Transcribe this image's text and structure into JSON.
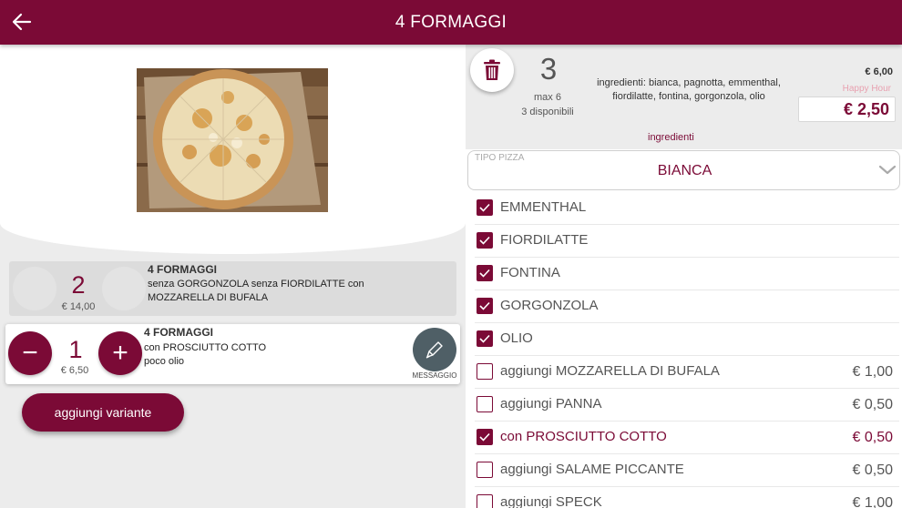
{
  "header": {
    "title": "4 FORMAGGI",
    "back_icon": "arrow-left-icon"
  },
  "colors": {
    "brand": "#7b0a36",
    "happy_hour": "#e8a1b0",
    "message_button": "#4f5f66"
  },
  "order_lines": [
    {
      "qty": "2",
      "price": "€ 14,00",
      "title": "4 FORMAGGI",
      "desc": " senza GORGONZOLA senza FIORDILATTE con MOZZARELLA DI BUFALA"
    },
    {
      "qty": "1",
      "price": "€ 6,50",
      "title": "4 FORMAGGI",
      "desc": " con PROSCIUTTO COTTO",
      "note": "poco olio"
    }
  ],
  "buttons": {
    "minus": "−",
    "plus": "+",
    "message": "MESSAGGIO",
    "add_variant": "aggiungi variante"
  },
  "detail": {
    "qty": "3",
    "max": "max 6",
    "available": "3 disponibili",
    "ingredients_desc": "ingredienti: bianca, pagnotta, emmenthal, fiordilatte, fontina, gorgonzola, olio",
    "old_price": "€ 6,00",
    "happy_hour": "Happy Hour",
    "price": "€ 2,50",
    "ingredients_tab": "ingredienti"
  },
  "pizza_type": {
    "label": "TIPO PIZZA",
    "value": "BIANCA"
  },
  "options": [
    {
      "name": "EMMENTHAL",
      "price": "",
      "checked": true
    },
    {
      "name": "FIORDILATTE",
      "price": "",
      "checked": true
    },
    {
      "name": "FONTINA",
      "price": "",
      "checked": true
    },
    {
      "name": "GORGONZOLA",
      "price": "",
      "checked": true
    },
    {
      "name": "OLIO",
      "price": "",
      "checked": true
    },
    {
      "name": "aggiungi MOZZARELLA DI BUFALA",
      "price": "€ 1,00",
      "checked": false
    },
    {
      "name": "aggiungi PANNA",
      "price": "€ 0,50",
      "checked": false
    },
    {
      "name": "con PROSCIUTTO COTTO",
      "price": "€ 0,50",
      "checked": true,
      "highlight": true
    },
    {
      "name": "aggiungi SALAME PICCANTE",
      "price": "€ 0,50",
      "checked": false
    },
    {
      "name": "aggiungi SPECK",
      "price": "€ 1,00",
      "checked": false
    }
  ]
}
